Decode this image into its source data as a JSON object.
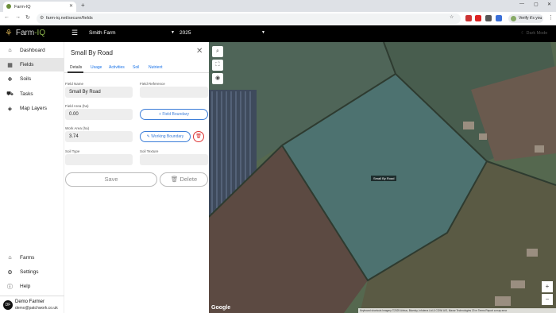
{
  "browser": {
    "tab_title": "Farm-IQ",
    "new_tab": "+",
    "url": "farm-iq.net/secure/fields",
    "profile_label": "Verify it's you"
  },
  "header": {
    "logo_text": "Farm",
    "logo_accent": "-IQ",
    "farm": "Smith Farm",
    "year": "2025",
    "dark_mode": "Dark Mode"
  },
  "sidebar": {
    "items": [
      {
        "label": "Dashboard",
        "icon": "home-icon"
      },
      {
        "label": "Fields",
        "icon": "map-icon"
      },
      {
        "label": "Soils",
        "icon": "soil-icon"
      },
      {
        "label": "Tasks",
        "icon": "truck-icon"
      },
      {
        "label": "Map Layers",
        "icon": "layers-icon"
      }
    ],
    "bottom_items": [
      {
        "label": "Farms",
        "icon": "home-icon"
      },
      {
        "label": "Settings",
        "icon": "gear-icon"
      },
      {
        "label": "Help",
        "icon": "info-icon"
      }
    ],
    "user": {
      "initials": "DF",
      "name": "Demo Farmer",
      "email": "demo@patchwork.co.uk"
    }
  },
  "panel": {
    "title": "Small By Road",
    "tabs": [
      "Details",
      "Usage",
      "Activities",
      "Soil",
      "Nutrient"
    ],
    "field_name_label": "Field Name",
    "field_name": "Small By Road",
    "field_reference_label": "Field Reference",
    "field_reference": "",
    "field_area_label": "Field Area (ha)",
    "field_area": "0.00",
    "field_boundary_button": "Field Boundary",
    "work_area_label": "Work Area (ha)",
    "work_area": "3.74",
    "working_boundary_button": "Working Boundary",
    "soil_type_label": "Soil Type",
    "soil_type": "",
    "soil_texture_label": "Soil Texture",
    "soil_texture": "",
    "save_button": "Save",
    "delete_button": "Delete"
  },
  "map": {
    "field_label": "Small By Road",
    "google": "Google",
    "attribution": "Keyboard shortcuts   Imagery ©2025 Airbus, Bluesky, Infoterra Ltd & COWI A/S, Maxar Technologies   20 m   Terms   Report a map error",
    "zoom_in": "+",
    "zoom_out": "−"
  }
}
